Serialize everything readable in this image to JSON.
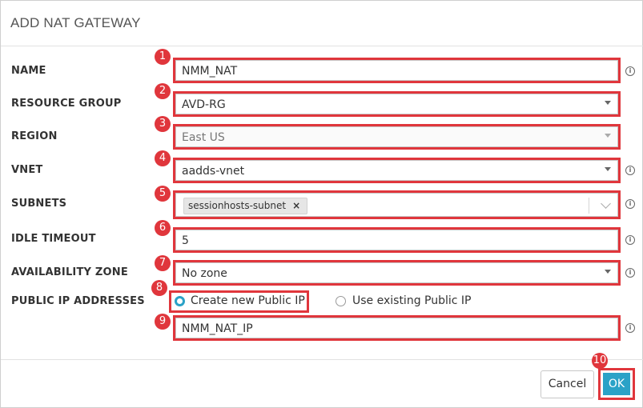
{
  "dialog": {
    "title": "ADD NAT GATEWAY"
  },
  "fields": {
    "name": {
      "label": "NAME",
      "value": "NMM_NAT",
      "badge": "1"
    },
    "resource_group": {
      "label": "RESOURCE GROUP",
      "value": "AVD-RG",
      "badge": "2"
    },
    "region": {
      "label": "REGION",
      "value": "East US",
      "badge": "3"
    },
    "vnet": {
      "label": "VNET",
      "value": "aadds-vnet",
      "badge": "4"
    },
    "subnets": {
      "label": "SUBNETS",
      "tag": "sessionhosts-subnet",
      "tag_remove": "×",
      "badge": "5"
    },
    "idle_timeout": {
      "label": "IDLE TIMEOUT",
      "value": "5",
      "badge": "6"
    },
    "availability_zone": {
      "label": "AVAILABILITY ZONE",
      "value": "No zone",
      "badge": "7"
    },
    "public_ip": {
      "label": "PUBLIC IP ADDRESSES",
      "option_new": "Create new Public IP",
      "option_existing": "Use existing Public IP",
      "selected": "Create new Public IP",
      "badge": "8"
    },
    "public_ip_name": {
      "value": "NMM_NAT_IP",
      "badge": "9"
    }
  },
  "footer": {
    "cancel_label": "Cancel",
    "ok_label": "OK",
    "ok_badge": "10"
  },
  "icons": {
    "info": "info-icon",
    "dropdown": "caret-down-icon",
    "chevron": "chevron-down-icon"
  },
  "colors": {
    "highlight": "#e0363c",
    "accent": "#2aa2c7"
  }
}
